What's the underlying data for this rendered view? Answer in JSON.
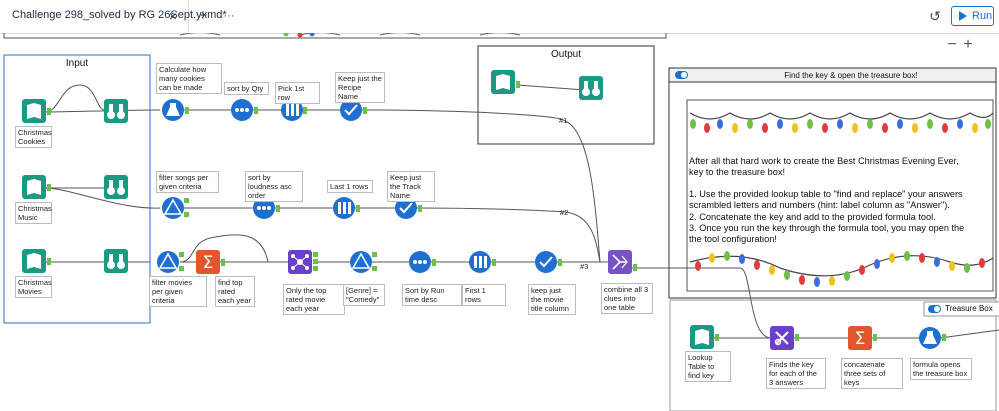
{
  "tabbar": {
    "tab_title": "Challenge 298_solved by RG 26Sept.yxmd*",
    "close_glyph": "×",
    "new_tab_glyph": "+",
    "more_glyph": "···",
    "history_glyph": "↺",
    "run_label": "Run"
  },
  "canvas": {
    "zoom_out": "−",
    "zoom_in": "+",
    "containers": {
      "input_title": "Input",
      "output_title": "Output",
      "find_key_title": "Find the key & open the treasure box!",
      "treasure_title": "Treasure Box"
    },
    "labels": {
      "xmas_cookies": "Christmas Cookies",
      "xmas_music": "Christmas Music",
      "xmas_movies": "Christmas Movies",
      "calc_cookies": "Calculate how many cookies can be made",
      "sort_qty": "sort by Qty",
      "pick_first": "Pick 1st row",
      "keep_recipe": "Keep just the Recipe Name",
      "filter_songs": "filter songs per given criteria",
      "sort_loudness": "sort by loudness asc order",
      "last_rows": "Last 1 rows",
      "keep_track": "Keep just the Track Name",
      "filter_movies": "filter movies per given criteria",
      "find_top": "find top rated each year",
      "only_top": "Only the top rated movie each year",
      "genre_comedy": "[Genre] = \"Comedy\"",
      "sort_runtime": "Sort by Run time desc",
      "first_rows": "First 1 rows",
      "keep_movie": "keep just the movie title column",
      "combine": "combine all 3 clues into one table",
      "lookup": "Lookup Table to find key",
      "finds_key": "Finds the key for each of the 3 answers",
      "concat_keys": "concatenate three sets of keys",
      "formula_opens": "formula opens the treasure box"
    },
    "conn": {
      "c1": "#1",
      "c2": "#2",
      "c3": "#3"
    },
    "instructions": {
      "l1": "After all that hard work to create the Best Christmas Evening Ever,",
      "l2": "key to the treasure box!",
      "l3": "1. Use the provided lookup table to \"find and replace\"  your answers",
      "l4": "scrambled letters and numbers (hint: label column as \"Answer\").",
      "l5": "2. Concatenate the key and add to the provided formula tool.",
      "l6": "3. Once you run the key through the formula tool, you may open the",
      "l7": "the tool configuration!"
    },
    "colors": {
      "input_tool": "#1a9a83",
      "browse_tool": "#1a9a83",
      "prep_tool": "#1f6fd1",
      "sort_tool": "#1f6fd1",
      "summarize_tool": "#e2562b",
      "transform_tool": "#6a3fc9",
      "join_tool": "#7553c6",
      "anchor": "#6cc04a"
    }
  }
}
